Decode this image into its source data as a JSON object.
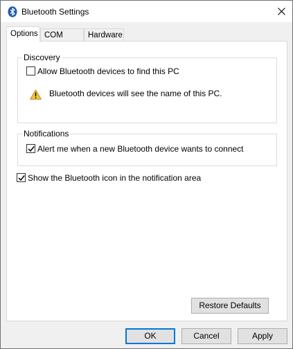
{
  "window": {
    "title": "Bluetooth Settings",
    "close_icon": "close-icon"
  },
  "tabs": [
    {
      "label": "Options",
      "active": true
    },
    {
      "label": "COM Ports",
      "active": false
    },
    {
      "label": "Hardware",
      "active": false
    }
  ],
  "discovery": {
    "legend": "Discovery",
    "allow_label": "Allow Bluetooth devices to find this PC",
    "allow_checked": false,
    "warning_icon": "warning-icon",
    "warning_text": "Bluetooth devices will see the name of this PC."
  },
  "notifications": {
    "legend": "Notifications",
    "alert_label": "Alert me when a new Bluetooth device wants to connect",
    "alert_checked": true
  },
  "show_icon": {
    "label": "Show the Bluetooth icon in the notification area",
    "checked": true
  },
  "buttons": {
    "restore_defaults": "Restore Defaults",
    "ok": "OK",
    "cancel": "Cancel",
    "apply": "Apply"
  },
  "colors": {
    "bluetooth_blue": "#1e5aa8",
    "default_button_border": "#0078d7",
    "warning_yellow": "#f6c43a"
  }
}
